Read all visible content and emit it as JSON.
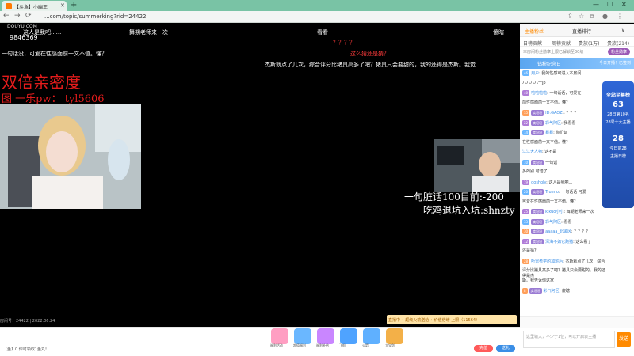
{
  "browser": {
    "tab_title": "【斗鱼】小幽王",
    "url": "...com/topic/summerking?rid=24422",
    "new_tab": "+",
    "nav": {
      "back": "←",
      "forward": "→",
      "reload": "⟳"
    },
    "win": {
      "min": "—",
      "max": "☐",
      "close": "✕"
    }
  },
  "stream": {
    "logo": "DOUYU.COM",
    "room_number": "9846369",
    "big_title": "双倍亲密度",
    "big_subtitle": "图 一乐pw： tyl5606",
    "overlay_line1": "一句脏话100目前:-200",
    "overlay_line2": "吃鸡退坑入坑:shnzty",
    "footer": "房间号：24422 | 2022.06.24",
    "danmaku": [
      {
        "text": "一这人是我吧......",
        "color": "#ffffff"
      },
      {
        "text": "舞期老师来一次",
        "color": "#ffffff"
      },
      {
        "text": "看看",
        "color": "#ffffff"
      },
      {
        "text": "傻瞎",
        "color": "#ffffff"
      },
      {
        "text": "？？？？",
        "color": "#ff3b3b"
      },
      {
        "text": "一句话没，可爱在性感面前一文不值。懂？",
        "color": "#ffffff"
      },
      {
        "text": "这么猜还是猜？",
        "color": "#ff3b3b"
      },
      {
        "text": "杰斯就点了几次，综合评分比猪具高多了吧？猪具只会要甜的，我的还得是杰斯。我觉",
        "color": "#ffffff"
      }
    ]
  },
  "panel": {
    "header": {
      "anchor_tab": "主播粉丝",
      "rank_tab": "直播排行",
      "extra": "∨"
    },
    "tabs": [
      "日榜贡献",
      "周榜贡献",
      "贵族(1万)",
      "贵族(214)"
    ],
    "notice": "本房间粉丝勋章上限已解锁至30级",
    "fans_btn": "粉丝勋章",
    "banner": "钻粉纪念日",
    "banner_sub": "今日开播！已签到",
    "chat": [
      {
        "lv": "46",
        "badge": "",
        "user": "用户",
        "msg": "我的性感可进入本房间"
      },
      {
        "lv": "",
        "badge": "",
        "user": "",
        "msg": "ハハハハ一jp"
      },
      {
        "lv": "40",
        "badge": "",
        "user": "啦啦啦啦",
        "msg": "一句话话，可爱在"
      },
      {
        "lv": "",
        "badge": "",
        "user": "",
        "msg": "前性感面前一文不值。懂？"
      },
      {
        "lv": "35",
        "badge": "卖坦坦",
        "user": "ID:GAOZI",
        "msg": "？？？"
      },
      {
        "lv": "22",
        "badge": "卖坦坦",
        "user": "彩气阿区",
        "msg": "我看看"
      },
      {
        "lv": "14",
        "badge": "卖坦坦",
        "user": "暴暴",
        "msg": "你们证"
      },
      {
        "lv": "",
        "badge": "",
        "user": "",
        "msg": "在性感面前一文不值。懂？"
      },
      {
        "lv": "",
        "badge": "",
        "user": "江江大人物",
        "msg": "这不是"
      },
      {
        "lv": "10",
        "badge": "卖坦坦",
        "user": "",
        "msg": "一句话"
      },
      {
        "lv": "",
        "badge": "",
        "user": "",
        "msg": "多的别 可惜了"
      },
      {
        "lv": "19",
        "badge": "",
        "user": "gosholy",
        "msg": "这人是我吧..."
      },
      {
        "lv": "20",
        "badge": "卖坦坦",
        "user": "Trueno",
        "msg": "一句话话 可爱"
      },
      {
        "lv": "",
        "badge": "",
        "user": "",
        "msg": "可爱在性感面前一文不值。懂？"
      },
      {
        "lv": "25",
        "badge": "卖坦坦",
        "user": "kikuo小小",
        "msg": "舞期老师来一次"
      },
      {
        "lv": "33",
        "badge": "卖坦坦",
        "user": "彩气阿区",
        "msg": "看看"
      },
      {
        "lv": "30",
        "badge": "卖坦坦",
        "user": "aaaaa_北黑风",
        "msg": "？？？？"
      },
      {
        "lv": "12",
        "badge": "卖坦坦",
        "user": "深海不如它跑猪",
        "msg": "这么看了"
      },
      {
        "lv": "",
        "badge": "",
        "user": "",
        "msg": "还是猜？"
      },
      {
        "lv": "28",
        "badge": "",
        "user": "听雷者学的加班后",
        "msg": "杰斯就点了几次，综合"
      },
      {
        "lv": "",
        "badge": "",
        "user": "",
        "msg": "评分比猪具高多了吧？猪具只会要甜的，我的还得是杰"
      },
      {
        "lv": "",
        "badge": "",
        "user": "",
        "msg": "斯。我告诉你这家"
      },
      {
        "lv": "8",
        "badge": "卖坦坦",
        "user": "彩气阿区",
        "msg": "傻瞎"
      }
    ],
    "rank_widget": {
      "title": "全站至尊榜",
      "rank1": "63",
      "label1": "28日第10名",
      "label2": "28号十大主播",
      "rank2": "28",
      "label3": "今日前28",
      "label4": "主播日榜"
    },
    "chat_placeholder": "这里输入，不少于1位，可以开启表主播",
    "send_label": "发送"
  },
  "toolbar": {
    "gifts": [
      {
        "label": "福利活动",
        "color": "#ff9ec2"
      },
      {
        "label": "超值福利",
        "color": "#6ab7ff"
      },
      {
        "label": "福利补给",
        "color": "#c986ff"
      },
      {
        "label": "飞船",
        "color": "#4fa3ff"
      },
      {
        "label": "火箭",
        "color": "#5fb0ff"
      },
      {
        "label": "大宝剑",
        "color": "#f3b048"
      }
    ],
    "bar_banner": "直播中 ∙ 超级火箭送给 ∙ 价值倍增 上限（11564）",
    "balance": "【鱼】0  你可领取1鱼丸!",
    "recharge": "充值",
    "gift_btn": "送礼"
  },
  "colors": {
    "tabbar": "#79c3a5",
    "danmaku_red": "#e41c1c",
    "accent_orange": "#ff8a00",
    "link_blue": "#3a8ee6"
  }
}
